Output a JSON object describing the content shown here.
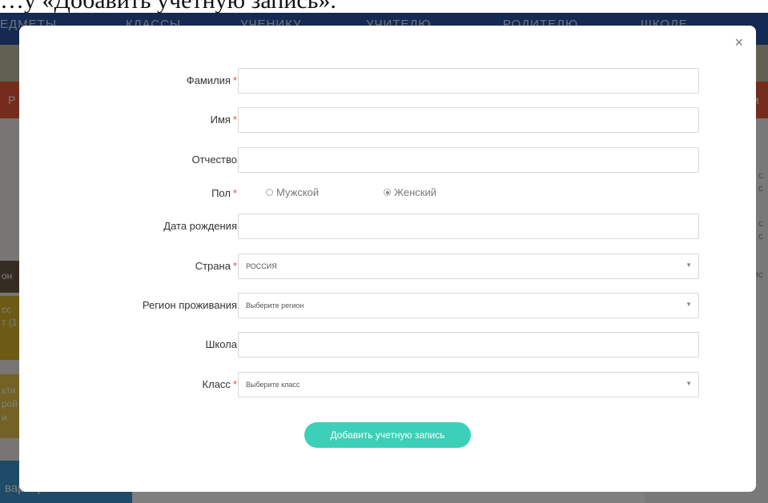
{
  "document": {
    "heading": "…у «Добавить учетную запись»."
  },
  "background": {
    "nav": [
      "ЕДМЕТЫ",
      "КЛАССЫ",
      "УЧЕНИКУ",
      "УЧИТЕЛЮ",
      "РОДИТЕЛЮ",
      "ШКОЛЕ"
    ],
    "orange_left": "Р",
    "orange_right": "и",
    "left_texts": [
      "он",
      "сс",
      "т (1",
      "кти",
      "рой",
      "и"
    ],
    "left_bottom": "варварита",
    "right_texts": [
      "с",
      "с",
      "с",
      "с",
      "ис"
    ]
  },
  "modal": {
    "close_label": "×",
    "fields": {
      "surname": {
        "label": "Фамилия",
        "required": "*",
        "value": ""
      },
      "name": {
        "label": "Имя",
        "required": "*",
        "value": ""
      },
      "patronymic": {
        "label": "Отчество",
        "value": ""
      },
      "gender": {
        "label": "Пол",
        "required": "*",
        "options": [
          "Мужской",
          "Женский"
        ],
        "selected": "Женский"
      },
      "birthdate": {
        "label": "Дата рождения",
        "value": ""
      },
      "country": {
        "label": "Страна",
        "required": "*",
        "value": "РОССИЯ"
      },
      "region": {
        "label": "Регион проживания",
        "value": "Выберите регион"
      },
      "school": {
        "label": "Школа",
        "value": ""
      },
      "class": {
        "label": "Класс",
        "required": "*",
        "value": "Выберите класс"
      }
    },
    "submit_label": "Добавить учетную запись",
    "caret_icon": "▼",
    "accent_color": "#3dd0b8",
    "required_color": "#e84b4b"
  }
}
